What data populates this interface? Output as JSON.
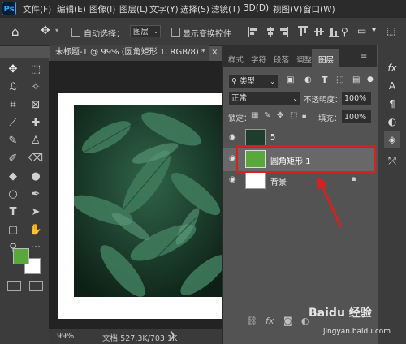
{
  "menu": {
    "items": [
      "文件(F)",
      "编辑(E)",
      "图像(I)",
      "图层(L)",
      "文字(Y)",
      "选择(S)",
      "滤镜(T)",
      "3D(D)",
      "视图(V)",
      "窗口(W)"
    ]
  },
  "options_bar": {
    "auto_select_label": "自动选择：",
    "auto_select_value": "图层",
    "show_transform_label": "显示变换控件",
    "more": "···"
  },
  "document": {
    "tab_title": "未标题-1 @ 99% (圆角矩形 1, RGB/8) *",
    "tab_close": "×",
    "zoom": "99%",
    "doc_info": "文档:527.3K/703.1K"
  },
  "colors": {
    "foreground": "#5aa83c",
    "background": "#ffffff",
    "highlight": "#d92020",
    "layer_selected": "#686868"
  },
  "panel": {
    "tabs": [
      "样式",
      "字符",
      "段落",
      "调整",
      "图层"
    ],
    "active_tab": "图层",
    "filter_label": "类型",
    "blend_mode": "正常",
    "opacity_label": "不透明度：",
    "opacity_value": "100%",
    "lock_label": "锁定：",
    "fill_label": "填充：",
    "fill_value": "100%",
    "layers": [
      {
        "name": "5",
        "selected": false
      },
      {
        "name": "圆角矩形 1",
        "selected": true
      },
      {
        "name": "背景",
        "selected": false
      }
    ]
  },
  "watermark": {
    "main": "Baidu 经验",
    "sub": "jingyan.baidu.com"
  }
}
